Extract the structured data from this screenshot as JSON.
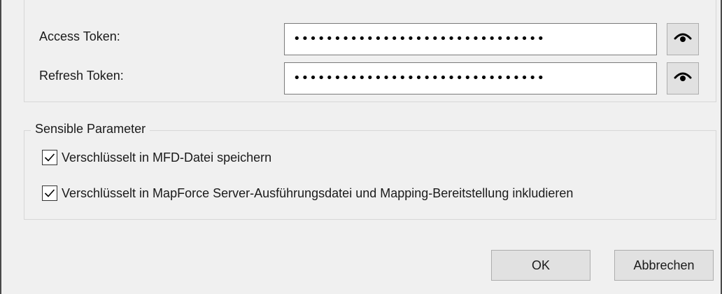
{
  "credentials": {
    "access_token": {
      "label": "Access Token:",
      "value": "•••••••••••••••••••••••••••••••",
      "reveal_icon": "eye-icon"
    },
    "refresh_token": {
      "label": "Refresh Token:",
      "value": "•••••••••••••••••••••••••••••••",
      "reveal_icon": "eye-icon"
    }
  },
  "sensitive": {
    "title": "Sensible Parameter",
    "options": [
      {
        "label": "Verschlüsselt in MFD-Datei speichern",
        "checked": true
      },
      {
        "label": "Verschlüsselt in MapForce Server-Ausführungsdatei und Mapping-Bereitstellung inkludieren",
        "checked": true
      }
    ]
  },
  "buttons": {
    "ok": "OK",
    "cancel": "Abbrechen"
  }
}
